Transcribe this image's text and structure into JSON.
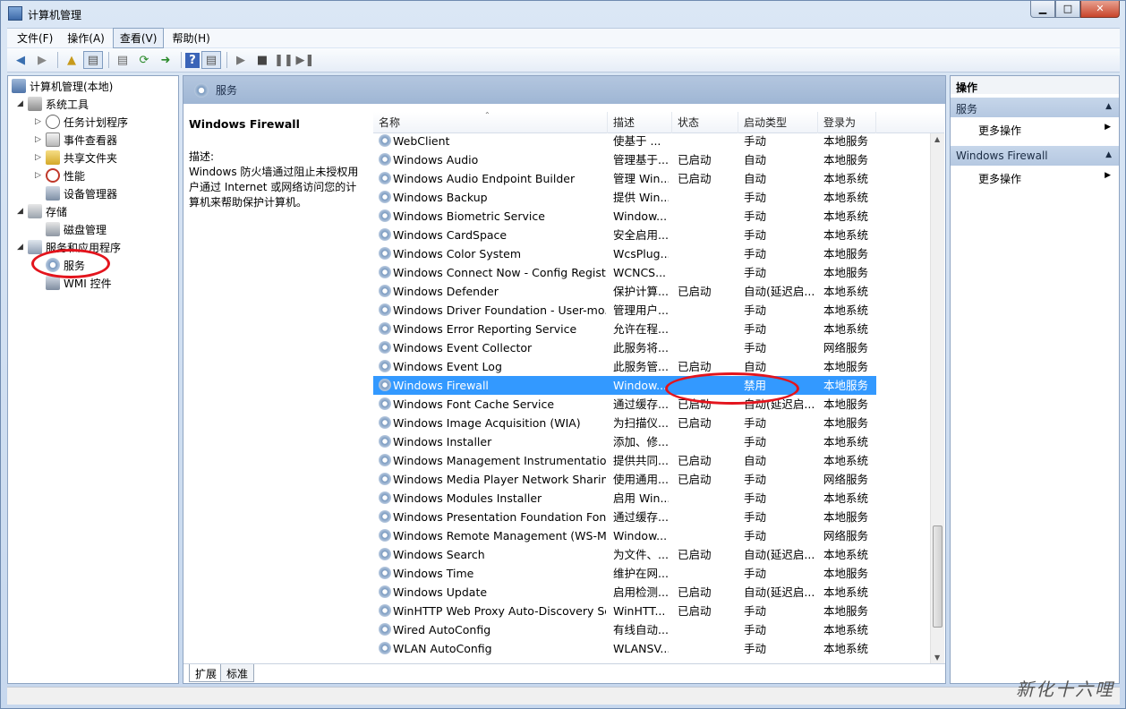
{
  "window": {
    "title": "计算机管理",
    "min": "▁",
    "max": "□",
    "close": "✕"
  },
  "menu": [
    "文件(F)",
    "操作(A)",
    "查看(V)",
    "帮助(H)"
  ],
  "tree": [
    {
      "label": "计算机管理(本地)",
      "icon": "computer-icon"
    },
    {
      "label": "系统工具",
      "icon": "tools-icon"
    },
    {
      "label": "任务计划程序",
      "icon": "clock-icon"
    },
    {
      "label": "事件查看器",
      "icon": "event-viewer-icon"
    },
    {
      "label": "共享文件夹",
      "icon": "shared-folder-icon"
    },
    {
      "label": "性能",
      "icon": "performance-icon"
    },
    {
      "label": "设备管理器",
      "icon": "device-manager-icon"
    },
    {
      "label": "存储",
      "icon": "storage-icon"
    },
    {
      "label": "磁盘管理",
      "icon": "disk-icon"
    },
    {
      "label": "服务和应用程序",
      "icon": "services-apps-icon"
    },
    {
      "label": "服务",
      "icon": "services-icon"
    },
    {
      "label": "WMI 控件",
      "icon": "wmi-icon"
    }
  ],
  "center": {
    "header": "服务",
    "selected_name": "Windows Firewall",
    "desc_label": "描述:",
    "desc_text": "Windows 防火墙通过阻止未授权用户通过 Internet 或网络访问您的计算机来帮助保护计算机。"
  },
  "columns": [
    "名称",
    "描述",
    "状态",
    "启动类型",
    "登录为"
  ],
  "services": [
    [
      "WebClient",
      "使基于 ...",
      "",
      "手动",
      "本地服务"
    ],
    [
      "Windows Audio",
      "管理基于...",
      "已启动",
      "自动",
      "本地服务"
    ],
    [
      "Windows Audio Endpoint Builder",
      "管理 Win...",
      "已启动",
      "自动",
      "本地系统"
    ],
    [
      "Windows Backup",
      "提供 Win...",
      "",
      "手动",
      "本地系统"
    ],
    [
      "Windows Biometric Service",
      "Window...",
      "",
      "手动",
      "本地系统"
    ],
    [
      "Windows CardSpace",
      "安全启用...",
      "",
      "手动",
      "本地系统"
    ],
    [
      "Windows Color System",
      "WcsPlug...",
      "",
      "手动",
      "本地服务"
    ],
    [
      "Windows Connect Now - Config Regist...",
      "WCNCS...",
      "",
      "手动",
      "本地服务"
    ],
    [
      "Windows Defender",
      "保护计算...",
      "已启动",
      "自动(延迟启...",
      "本地系统"
    ],
    [
      "Windows Driver Foundation - User-mo...",
      "管理用户...",
      "",
      "手动",
      "本地系统"
    ],
    [
      "Windows Error Reporting Service",
      "允许在程...",
      "",
      "手动",
      "本地系统"
    ],
    [
      "Windows Event Collector",
      "此服务将...",
      "",
      "手动",
      "网络服务"
    ],
    [
      "Windows Event Log",
      "此服务管...",
      "已启动",
      "自动",
      "本地服务"
    ],
    [
      "Windows Firewall",
      "Window...",
      "",
      "禁用",
      "本地服务"
    ],
    [
      "Windows Font Cache Service",
      "通过缓存...",
      "已启动",
      "自动(延迟启...",
      "本地服务"
    ],
    [
      "Windows Image Acquisition (WIA)",
      "为扫描仪...",
      "已启动",
      "手动",
      "本地服务"
    ],
    [
      "Windows Installer",
      "添加、修...",
      "",
      "手动",
      "本地系统"
    ],
    [
      "Windows Management Instrumentation",
      "提供共同...",
      "已启动",
      "自动",
      "本地系统"
    ],
    [
      "Windows Media Player Network Sharin...",
      "使用通用...",
      "已启动",
      "手动",
      "网络服务"
    ],
    [
      "Windows Modules Installer",
      "启用 Win...",
      "",
      "手动",
      "本地系统"
    ],
    [
      "Windows Presentation Foundation Font...",
      "通过缓存...",
      "",
      "手动",
      "本地服务"
    ],
    [
      "Windows Remote Management (WS-M...",
      "Window...",
      "",
      "手动",
      "网络服务"
    ],
    [
      "Windows Search",
      "为文件、...",
      "已启动",
      "自动(延迟启...",
      "本地系统"
    ],
    [
      "Windows Time",
      "维护在网...",
      "",
      "手动",
      "本地服务"
    ],
    [
      "Windows Update",
      "启用检测...",
      "已启动",
      "自动(延迟启...",
      "本地系统"
    ],
    [
      "WinHTTP Web Proxy Auto-Discovery Se...",
      "WinHTT...",
      "已启动",
      "手动",
      "本地服务"
    ],
    [
      "Wired AutoConfig",
      "有线自动...",
      "",
      "手动",
      "本地系统"
    ],
    [
      "WLAN AutoConfig",
      "WLANSV...",
      "",
      "手动",
      "本地系统"
    ]
  ],
  "tabs": [
    "扩展",
    "标准"
  ],
  "actions": {
    "title": "操作",
    "section1": "服务",
    "more1": "更多操作",
    "section2": "Windows Firewall",
    "more2": "更多操作"
  },
  "watermark": "新化十六哩",
  "colors": {
    "selection": "#3399ff",
    "annotation": "#e3141d"
  }
}
